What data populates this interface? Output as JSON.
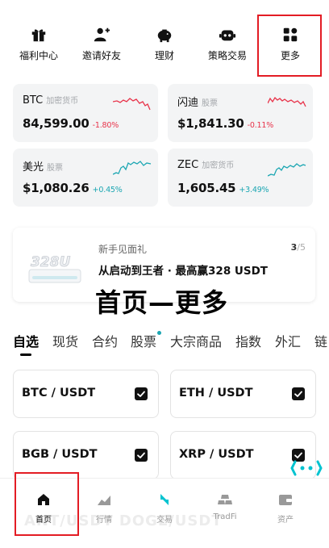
{
  "top_menu": {
    "items": [
      {
        "label": "福利中心",
        "icon": "gift-icon"
      },
      {
        "label": "邀请好友",
        "icon": "add-user-icon"
      },
      {
        "label": "理财",
        "icon": "piggy-bank-icon"
      },
      {
        "label": "策略交易",
        "icon": "robot-icon"
      },
      {
        "label": "更多",
        "icon": "grid-more-icon"
      }
    ]
  },
  "markets": [
    {
      "symbol": "BTC",
      "category": "加密货币",
      "price": "84,599.00",
      "change": "-1.80%",
      "trend": "down"
    },
    {
      "symbol": "闪迪",
      "category": "股票",
      "price": "$1,841.30",
      "change": "-0.11%",
      "trend": "down"
    },
    {
      "symbol": "美光",
      "category": "股票",
      "price": "$1,080.26",
      "change": "+0.45%",
      "trend": "up"
    },
    {
      "symbol": "ZEC",
      "category": "加密货币",
      "price": "1,605.45",
      "change": "+3.49%",
      "trend": "up"
    }
  ],
  "banner": {
    "subtitle": "新手见面礼",
    "title": "从启动到王者 · 最高赢328 USDT",
    "page_current": "3",
    "page_total": "/5",
    "art_text": "328U"
  },
  "overlay_title": "首页—更多",
  "tabs": [
    "自选",
    "现货",
    "合约",
    "股票",
    "大宗商品",
    "指数",
    "外汇",
    "链"
  ],
  "pairs": [
    {
      "name": "BTC / USDT"
    },
    {
      "name": "ETH / USDT"
    },
    {
      "name": "BGB / USDT"
    },
    {
      "name": "XRP / USDT"
    }
  ],
  "bottom_nav": {
    "ghost_text": "ANT/USDT        DOGE/USDT",
    "items": [
      {
        "label": "首页",
        "icon": "home-icon"
      },
      {
        "label": "行情",
        "icon": "chart-icon"
      },
      {
        "label": "交易",
        "icon": "trade-icon"
      },
      {
        "label": "TradFi",
        "icon": "gold-bars-icon"
      },
      {
        "label": "资产",
        "icon": "wallet-icon"
      }
    ]
  },
  "colors": {
    "down": "#e8334a",
    "up": "#1ba6b2",
    "highlight": "#e31c24",
    "accent": "#00c3d0"
  }
}
